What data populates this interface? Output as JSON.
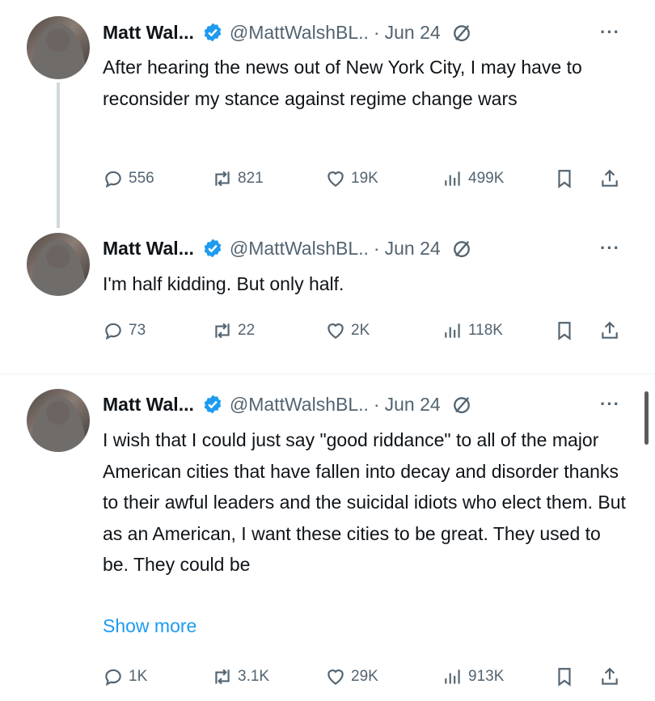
{
  "tweets": [
    {
      "name": "Matt Wal...",
      "handle": "@MattWalshBL..",
      "sep": "·",
      "date": "Jun 24",
      "more": "···",
      "text": "After hearing the news out of New York City, I may have to reconsider my stance against regime change wars",
      "show_more": "",
      "replies": "556",
      "reposts": "821",
      "likes": "19K",
      "views": "499K"
    },
    {
      "name": "Matt Wal...",
      "handle": "@MattWalshBL..",
      "sep": "·",
      "date": "Jun 24",
      "more": "···",
      "text": "I'm half kidding. But only half.",
      "show_more": "",
      "replies": "73",
      "reposts": "22",
      "likes": "2K",
      "views": "118K"
    },
    {
      "name": "Matt Wal...",
      "handle": "@MattWalshBL..",
      "sep": "·",
      "date": "Jun 24",
      "more": "···",
      "text": "I wish that I could just say \"good riddance\" to all of the major American cities that have fallen into decay and disorder thanks to their awful leaders and the suicidal idiots who elect them. But as an American, I want these cities to be great. They used to be. They could be",
      "show_more": "Show more",
      "replies": "1K",
      "reposts": "3.1K",
      "likes": "29K",
      "views": "913K"
    }
  ],
  "icons": {
    "verified": "verified-badge-icon",
    "grok": "grok-icon",
    "reply": "reply-icon",
    "repost": "repost-icon",
    "like": "like-icon",
    "views": "views-icon",
    "bookmark": "bookmark-icon",
    "share": "share-icon"
  },
  "colors": {
    "accent": "#1d9bf0",
    "muted": "#536471",
    "text": "#0f1419"
  }
}
